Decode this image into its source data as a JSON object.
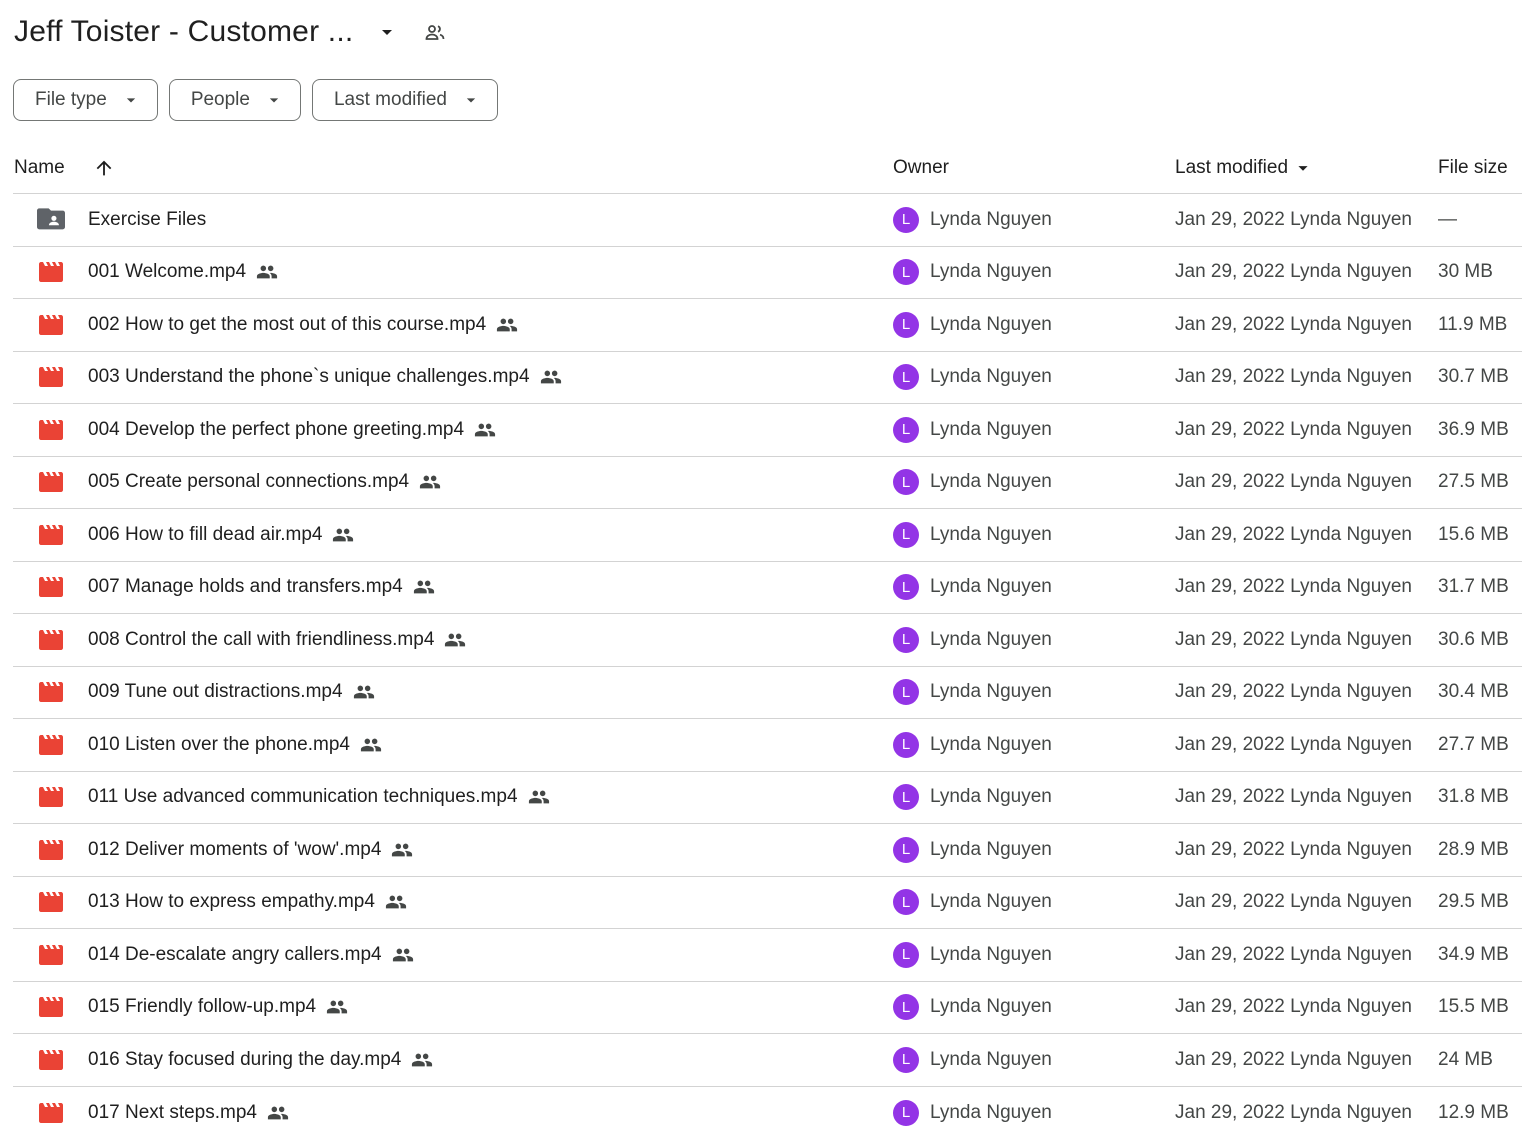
{
  "header": {
    "title": "Jeff Toister - Customer ...",
    "caret_icon": "arrow-drop-down-icon",
    "shared_icon": "shared-folder-people-icon"
  },
  "filters": [
    {
      "label": "File type"
    },
    {
      "label": "People"
    },
    {
      "label": "Last modified"
    }
  ],
  "columns": {
    "name": "Name",
    "owner": "Owner",
    "last_modified": "Last modified",
    "file_size": "File size"
  },
  "colors": {
    "folder_icon": "#5f6368",
    "video_icon": "#ea4335",
    "avatar_bg": "#9334e6"
  },
  "rows": [
    {
      "type": "folder",
      "name": "Exercise Files",
      "shared": false,
      "owner_initial": "L",
      "owner": "Lynda Nguyen",
      "modified": "Jan 29, 2022 Lynda Nguyen",
      "size": "—"
    },
    {
      "type": "video",
      "name": "001 Welcome.mp4",
      "shared": true,
      "owner_initial": "L",
      "owner": "Lynda Nguyen",
      "modified": "Jan 29, 2022 Lynda Nguyen",
      "size": "30 MB"
    },
    {
      "type": "video",
      "name": "002 How to get the most out of this course.mp4",
      "shared": true,
      "owner_initial": "L",
      "owner": "Lynda Nguyen",
      "modified": "Jan 29, 2022 Lynda Nguyen",
      "size": "11.9 MB"
    },
    {
      "type": "video",
      "name": "003 Understand the phone`s unique challenges.mp4",
      "shared": true,
      "owner_initial": "L",
      "owner": "Lynda Nguyen",
      "modified": "Jan 29, 2022 Lynda Nguyen",
      "size": "30.7 MB"
    },
    {
      "type": "video",
      "name": "004 Develop the perfect phone greeting.mp4",
      "shared": true,
      "owner_initial": "L",
      "owner": "Lynda Nguyen",
      "modified": "Jan 29, 2022 Lynda Nguyen",
      "size": "36.9 MB"
    },
    {
      "type": "video",
      "name": "005 Create personal connections.mp4",
      "shared": true,
      "owner_initial": "L",
      "owner": "Lynda Nguyen",
      "modified": "Jan 29, 2022 Lynda Nguyen",
      "size": "27.5 MB"
    },
    {
      "type": "video",
      "name": "006 How to fill dead air.mp4",
      "shared": true,
      "owner_initial": "L",
      "owner": "Lynda Nguyen",
      "modified": "Jan 29, 2022 Lynda Nguyen",
      "size": "15.6 MB"
    },
    {
      "type": "video",
      "name": "007 Manage holds and transfers.mp4",
      "shared": true,
      "owner_initial": "L",
      "owner": "Lynda Nguyen",
      "modified": "Jan 29, 2022 Lynda Nguyen",
      "size": "31.7 MB"
    },
    {
      "type": "video",
      "name": "008 Control the call with friendliness.mp4",
      "shared": true,
      "owner_initial": "L",
      "owner": "Lynda Nguyen",
      "modified": "Jan 29, 2022 Lynda Nguyen",
      "size": "30.6 MB"
    },
    {
      "type": "video",
      "name": "009 Tune out distractions.mp4",
      "shared": true,
      "owner_initial": "L",
      "owner": "Lynda Nguyen",
      "modified": "Jan 29, 2022 Lynda Nguyen",
      "size": "30.4 MB"
    },
    {
      "type": "video",
      "name": "010 Listen over the phone.mp4",
      "shared": true,
      "owner_initial": "L",
      "owner": "Lynda Nguyen",
      "modified": "Jan 29, 2022 Lynda Nguyen",
      "size": "27.7 MB"
    },
    {
      "type": "video",
      "name": "011 Use advanced communication techniques.mp4",
      "shared": true,
      "owner_initial": "L",
      "owner": "Lynda Nguyen",
      "modified": "Jan 29, 2022 Lynda Nguyen",
      "size": "31.8 MB"
    },
    {
      "type": "video",
      "name": "012 Deliver moments of 'wow'.mp4",
      "shared": true,
      "owner_initial": "L",
      "owner": "Lynda Nguyen",
      "modified": "Jan 29, 2022 Lynda Nguyen",
      "size": "28.9 MB"
    },
    {
      "type": "video",
      "name": "013 How to express empathy.mp4",
      "shared": true,
      "owner_initial": "L",
      "owner": "Lynda Nguyen",
      "modified": "Jan 29, 2022 Lynda Nguyen",
      "size": "29.5 MB"
    },
    {
      "type": "video",
      "name": "014 De-escalate angry callers.mp4",
      "shared": true,
      "owner_initial": "L",
      "owner": "Lynda Nguyen",
      "modified": "Jan 29, 2022 Lynda Nguyen",
      "size": "34.9 MB"
    },
    {
      "type": "video",
      "name": "015 Friendly follow-up.mp4",
      "shared": true,
      "owner_initial": "L",
      "owner": "Lynda Nguyen",
      "modified": "Jan 29, 2022 Lynda Nguyen",
      "size": "15.5 MB"
    },
    {
      "type": "video",
      "name": "016 Stay focused during the day.mp4",
      "shared": true,
      "owner_initial": "L",
      "owner": "Lynda Nguyen",
      "modified": "Jan 29, 2022 Lynda Nguyen",
      "size": "24 MB"
    },
    {
      "type": "video",
      "name": "017 Next steps.mp4",
      "shared": true,
      "owner_initial": "L",
      "owner": "Lynda Nguyen",
      "modified": "Jan 29, 2022 Lynda Nguyen",
      "size": "12.9 MB"
    }
  ]
}
